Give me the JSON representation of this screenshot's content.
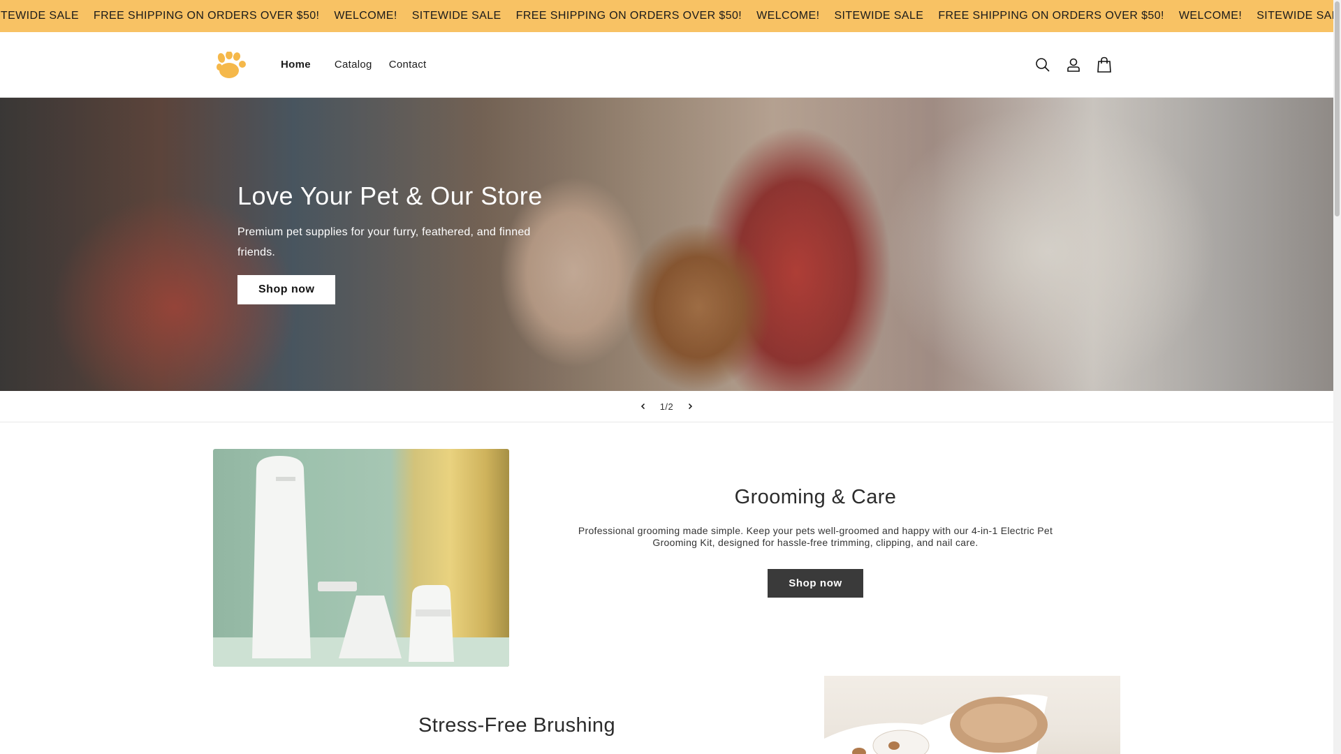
{
  "announcement": {
    "items": [
      "SITEWIDE SALE",
      "FREE SHIPPING ON ORDERS OVER $50!",
      "WELCOME!",
      "SITEWIDE SALE",
      "FREE SHIPPING ON ORDERS OVER $50!",
      "WELCOME!",
      "SITEWIDE SALE",
      "FREE SHIPPING ON ORDERS OVER $50!",
      "WELCOME!",
      "SITEWIDE SALE",
      "FREE SHIPPING ON ORDERS OVER $50!"
    ]
  },
  "header": {
    "logo_icon": "paw-logo-icon",
    "nav": [
      {
        "label": "Home",
        "active": true
      },
      {
        "label": "Catalog",
        "active": false
      },
      {
        "label": "Contact",
        "active": false
      }
    ],
    "icons": [
      "search-icon",
      "account-icon",
      "cart-icon"
    ]
  },
  "hero": {
    "title": "Love Your Pet & Our Store",
    "subtitle": "Premium pet supplies for your furry, feathered, and finned friends.",
    "button": "Shop now"
  },
  "slider": {
    "counter": "1/2",
    "prev_icon": "chevron-left-icon",
    "next_icon": "chevron-right-icon"
  },
  "grooming": {
    "title": "Grooming & Care",
    "description": "Professional grooming made simple. Keep your pets well-groomed and happy with our 4-in-1 Electric Pet Grooming Kit, designed for hassle-free trimming, clipping, and nail care.",
    "button": "Shop now"
  },
  "brushing": {
    "title": "Stress-Free Brushing"
  },
  "colors": {
    "announcement_bg": "#f8c264",
    "dark_button": "#3a3a3a"
  }
}
